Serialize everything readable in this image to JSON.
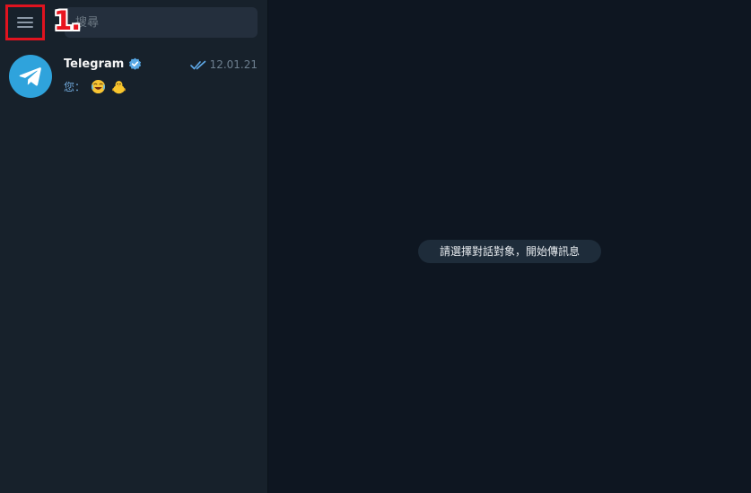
{
  "sidebar": {
    "search": {
      "placeholder": "搜尋"
    },
    "annotation": "1.",
    "chats": [
      {
        "name": "Telegram",
        "verified": true,
        "time": "12.01.21",
        "read": true,
        "preview_sender": "您：",
        "preview_emojis": [
          "laughing-emoji",
          "chick-emoji"
        ]
      }
    ]
  },
  "main": {
    "empty_hint": "請選擇對話對象，開始傳訊息"
  },
  "colors": {
    "sidebar_bg": "#17212b",
    "main_bg": "#0e1621",
    "accent": "#2fa3dc",
    "highlight": "#e0131f"
  }
}
